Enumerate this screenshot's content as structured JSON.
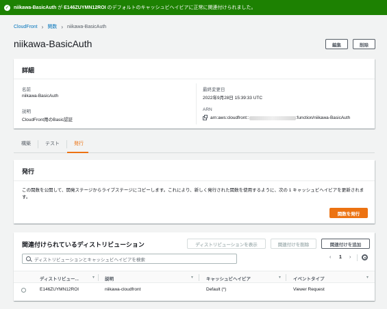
{
  "flash": {
    "function_name": "niikawa-BasicAuth",
    "text_mid": " が ",
    "distribution_id": "E146ZUYMN12ROI",
    "text_end": " のデフォルトのキャッシュビヘイビアに正常に関連付けられました。"
  },
  "breadcrumb": {
    "items": [
      "CloudFront",
      "関数",
      "niikawa-BasicAuth"
    ]
  },
  "page": {
    "title": "niikawa-BasicAuth",
    "edit_label": "編集",
    "delete_label": "削除"
  },
  "details": {
    "heading": "詳細",
    "name_label": "名前",
    "name_value": "niikawa-BasicAuth",
    "desc_label": "説明",
    "desc_value": "CloudFront用のBasic認証",
    "modified_label": "最終変更日",
    "modified_value": "2022年9月28日 15:39:33 UTC",
    "arn_label": "ARN",
    "arn_prefix": "arn:aws:cloudfront::",
    "arn_suffix": ":function/niikawa-BasicAuth"
  },
  "tabs": [
    "構築",
    "テスト",
    "発行"
  ],
  "publish": {
    "heading": "発行",
    "description": "この関数を公開して、開発ステージからライブステージにコピーします。これにより、新しく発行された関数を使用するように、次の 1 キャッシュビヘイビアを更新されます。",
    "button_label": "関数を発行"
  },
  "associations": {
    "heading": "関連付けられているディストリビューション",
    "view_label": "ディストリビューションを表示",
    "remove_label": "関連付けを削除",
    "add_label": "関連付けを追加",
    "search_placeholder": "ディストリビューションとキャッシュビヘイビアを検索",
    "page_number": "1",
    "columns": [
      "ディストリビュー...",
      "説明",
      "キャッシュビヘイビア",
      "イベントタイプ"
    ],
    "rows": [
      {
        "distribution": "E146ZUYMN12ROI",
        "description": "niikawa-cloudfront",
        "behavior": "Default (*)",
        "event": "Viewer Request"
      }
    ]
  },
  "colors": {
    "success": "#1d8102",
    "accent": "#ec7211",
    "link": "#0073bb"
  }
}
